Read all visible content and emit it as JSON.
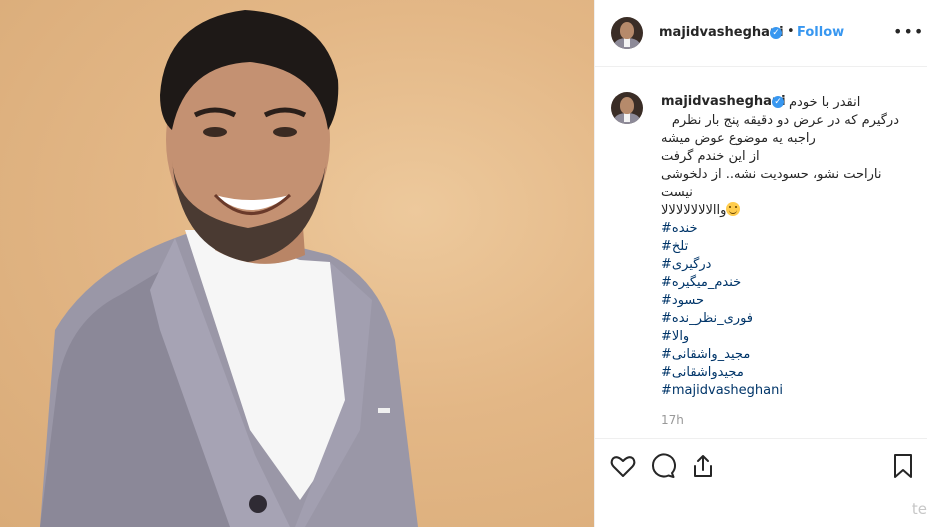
{
  "post": {
    "username": "majidvasheghani",
    "follow_label": "Follow",
    "separator": "•",
    "more_label": "•••",
    "caption_username": "majidvasheghani",
    "caption_lines": [
      "انقدر با خودم",
      "درگیرم که در عرض دو دقیقه پنج بار نظرم",
      "راجبه یه موضوع عوض میشه",
      "از این خندم گرفت",
      "ناراحت نشو، حسودیت نشه.. از دلخوشی",
      "نیست",
      "واالالالالالالالا"
    ],
    "hashtags": [
      "#خنده",
      "#تلخ",
      "#درگیری",
      "#خندم_میگیره",
      "#حسود",
      "#فوری_نظر_نده",
      "#والا",
      "#مجید_واشقانی",
      "#مجیدواشقانی",
      "#majidvasheghani"
    ],
    "time_ago": "17h",
    "partial_text": "te"
  },
  "icons": {
    "like": "heart-icon",
    "comment": "comment-icon",
    "share": "share-icon",
    "save": "bookmark-icon",
    "verified": "verified-badge-icon",
    "emoji": "smiling-face-emoji"
  },
  "colors": {
    "link": "#3897f0",
    "hashtag": "#003569",
    "text": "#262626",
    "muted": "#999999",
    "photo_background": "#e3b786"
  }
}
